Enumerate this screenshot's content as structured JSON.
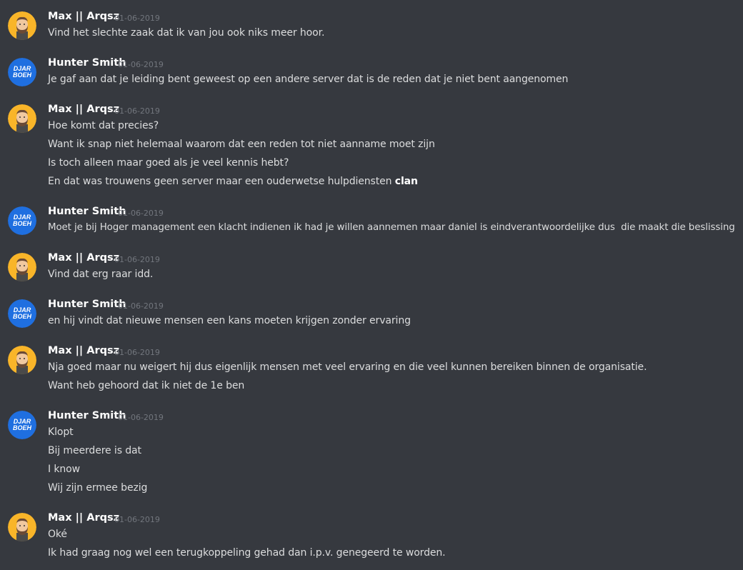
{
  "users": {
    "max": {
      "name": "Max || Arqsz",
      "avatar_icon": "bearded-man-avatar-icon"
    },
    "hunter": {
      "name": "Hunter Smith",
      "avatar_icon": "djarboeh-logo-avatar-icon",
      "avatar_text_1": "DJAR",
      "avatar_text_2": "BOEH"
    }
  },
  "messages": [
    {
      "author": "Max || Arqsz",
      "timestamp": "01-06-2019",
      "lines": [
        "Vind het slechte zaak dat ik van jou ook niks meer hoor."
      ]
    },
    {
      "author": "Hunter Smith",
      "timestamp": "01-06-2019",
      "lines": [
        "Je gaf aan dat je leiding bent geweest op een andere server dat is de reden dat je niet bent aangenomen"
      ]
    },
    {
      "author": "Max || Arqsz",
      "timestamp": "01-06-2019",
      "lines": [
        "Hoe komt dat precies?",
        "Want ik snap niet helemaal waarom dat een reden tot niet aanname moet zijn",
        "Is toch alleen maar goed als je veel kennis hebt?",
        "En dat was trouwens geen server maar een ouderwetse hulpdiensten ",
        "clan"
      ]
    },
    {
      "author": "Hunter Smith",
      "timestamp": "01-06-2019",
      "lines": [
        "Moet je bij Hoger management een klacht indienen ik had je willen aannemen maar daniel is eindverantwoordelijke dus  die maakt die beslissing"
      ]
    },
    {
      "author": "Max || Arqsz",
      "timestamp": "01-06-2019",
      "lines": [
        "Vind dat erg raar idd."
      ]
    },
    {
      "author": "Hunter Smith",
      "timestamp": "01-06-2019",
      "lines": [
        "en hij vindt dat nieuwe mensen een kans moeten krijgen zonder ervaring"
      ]
    },
    {
      "author": "Max || Arqsz",
      "timestamp": "01-06-2019",
      "lines": [
        "Nja goed maar nu weigert hij dus eigenlijk mensen met veel ervaring en die veel kunnen bereiken binnen de organisatie.",
        "Want heb gehoord dat ik niet de 1e ben"
      ]
    },
    {
      "author": "Hunter Smith",
      "timestamp": "01-06-2019",
      "lines": [
        "Klopt",
        "Bij meerdere is dat",
        "I know",
        "Wij zijn ermee bezig"
      ]
    },
    {
      "author": "Max || Arqsz",
      "timestamp": "01-06-2019",
      "lines": [
        "Oké",
        "Ik had graag nog wel een terugkoppeling gehad dan i.p.v. genegeerd te worden."
      ]
    }
  ]
}
